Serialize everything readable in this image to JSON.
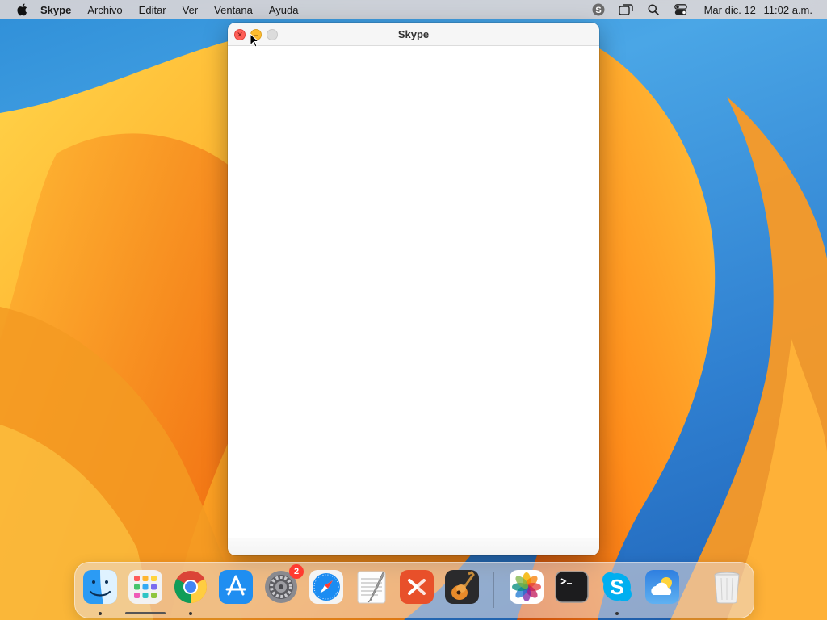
{
  "menubar": {
    "app_name": "Skype",
    "menus": [
      "Archivo",
      "Editar",
      "Ver",
      "Ventana",
      "Ayuda"
    ],
    "clock_date": "Mar dic. 12",
    "clock_time": "11:02 a.m.",
    "status_icons": [
      "skype-status-icon",
      "screen-mirroring-icon",
      "spotlight-search-icon",
      "control-center-icon"
    ]
  },
  "window": {
    "title": "Skype",
    "controls": [
      "close",
      "minimize",
      "zoom"
    ]
  },
  "dock": {
    "apps": [
      {
        "name": "Finder",
        "icon": "finder-icon",
        "running": true
      },
      {
        "name": "Launchpad",
        "icon": "launchpad-icon",
        "running": false
      },
      {
        "name": "Google Chrome",
        "icon": "chrome-icon",
        "running": true
      },
      {
        "name": "App Store",
        "icon": "app-store-icon",
        "running": false
      },
      {
        "name": "System Settings",
        "icon": "system-settings-icon",
        "running": false,
        "badge": "2"
      },
      {
        "name": "Safari",
        "icon": "safari-icon",
        "running": false
      },
      {
        "name": "TextEdit",
        "icon": "textedit-icon",
        "running": false
      },
      {
        "name": "Remote Desktop",
        "icon": "remote-desktop-icon",
        "running": false
      },
      {
        "name": "GarageBand",
        "icon": "garageband-icon",
        "running": false
      },
      {
        "name": "Photos",
        "icon": "photos-icon",
        "running": false
      },
      {
        "name": "Terminal",
        "icon": "terminal-icon",
        "running": false
      },
      {
        "name": "Skype",
        "icon": "skype-icon",
        "running": true
      },
      {
        "name": "Weather",
        "icon": "weather-icon",
        "running": false
      },
      {
        "name": "Trash",
        "icon": "trash-icon",
        "running": false
      }
    ],
    "system_settings_badge": "2"
  },
  "colors": {
    "accent_orange": "#f7941d",
    "skype_blue": "#00aff0",
    "close_red": "#ff5f57",
    "minimize_yellow": "#febc2e"
  }
}
